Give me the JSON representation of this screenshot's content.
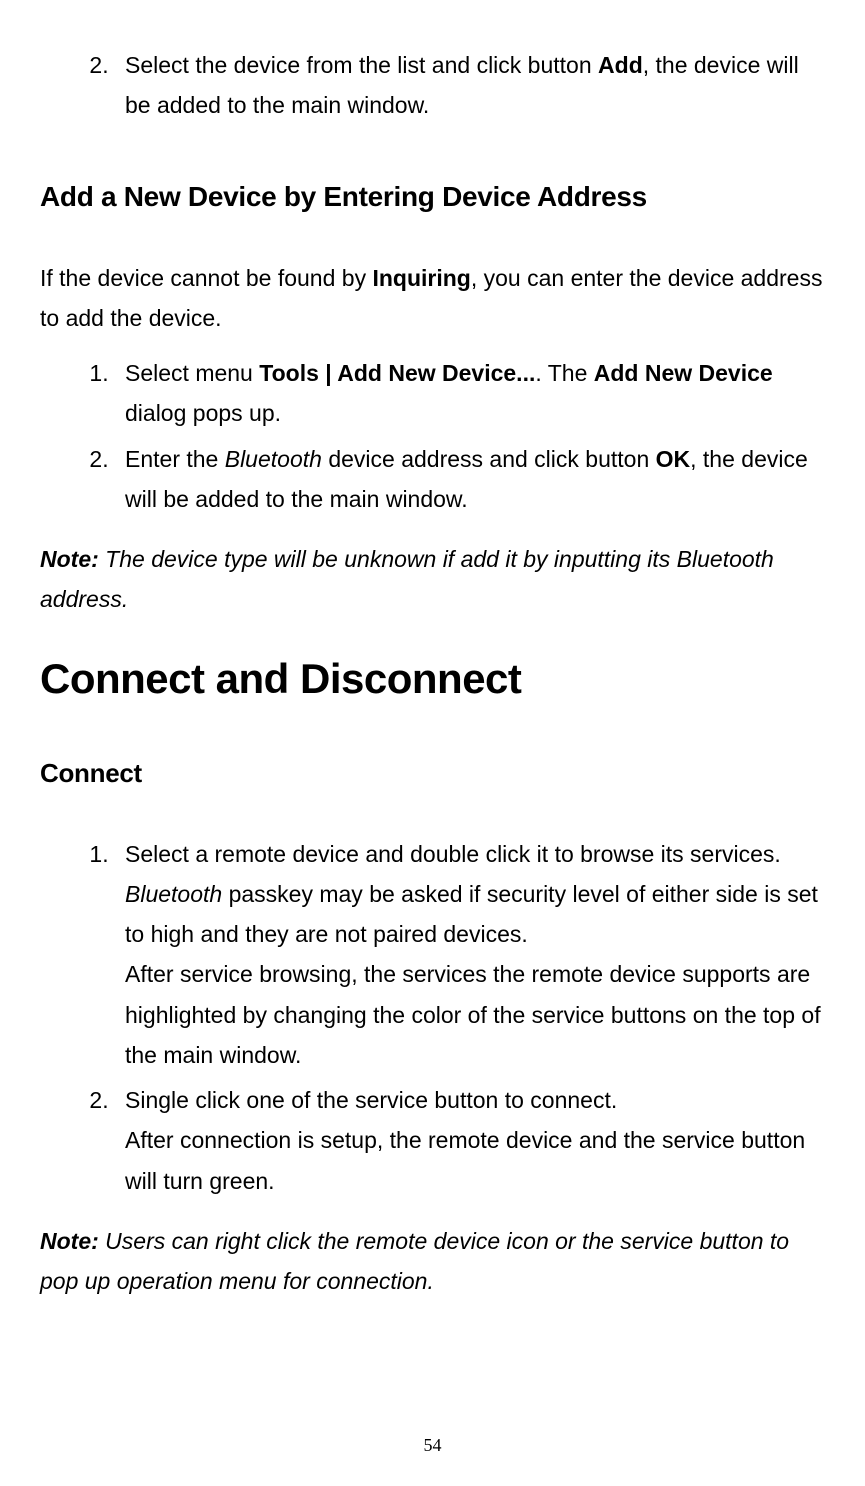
{
  "list1": {
    "item2": {
      "prefix": "Select the device from the list and click button ",
      "bold": "Add",
      "suffix": ", the device will be added to the main window."
    }
  },
  "heading2_1": "Add a New Device by Entering Device Address",
  "para1": {
    "prefix": "If the device cannot be found by ",
    "bold": "Inquiring",
    "suffix": ", you can enter the device address to add the device."
  },
  "list2": {
    "item1": {
      "prefix": "Select menu ",
      "bold1": "Tools | Add New Device...",
      "middle": ". The ",
      "bold2": "Add New Device",
      "suffix": " dialog pops up."
    },
    "item2": {
      "prefix": "Enter the ",
      "italic": "Bluetooth",
      "middle": " device address and click button ",
      "bold": "OK",
      "suffix": ", the device will be added to the main window."
    }
  },
  "note1": {
    "label": "Note:",
    "text": " The device type will be unknown if add it by inputting its Bluetooth address."
  },
  "heading1": "Connect and Disconnect",
  "heading3": "Connect",
  "list3": {
    "item1": {
      "line1": "Select a remote device and double click it to browse its services.",
      "line2_italic": "Bluetooth",
      "line2_rest": " passkey may be asked if security level of either side is set to high and they are not paired devices.",
      "line3": "After service browsing, the services the remote device supports are highlighted by changing the color of the service buttons on the top of the main window."
    },
    "item2": {
      "line1": "Single click one of the service button to connect.",
      "line2": "After connection is setup, the remote device and the service button will turn green."
    }
  },
  "note2": {
    "label": "Note:",
    "text": " Users can right click the remote device icon or the service button to pop up operation menu for connection."
  },
  "pageNumber": "54"
}
